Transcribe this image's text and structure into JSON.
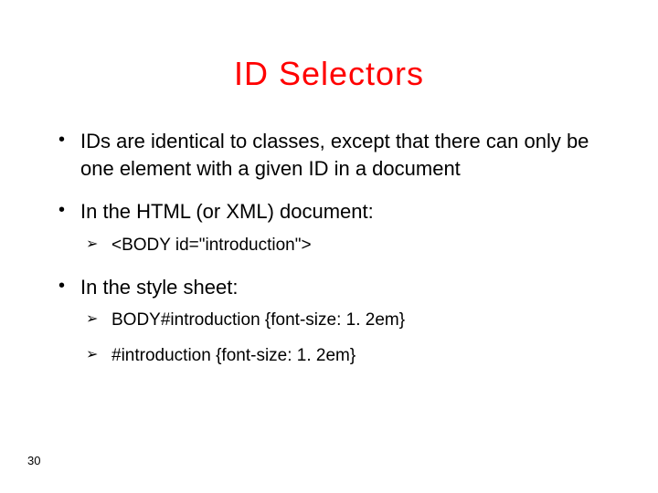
{
  "title": "ID Selectors",
  "bullets": [
    {
      "text": "IDs are identical to classes, except that there can only be one element with a given ID in a document",
      "subitems": []
    },
    {
      "text": "In the HTML (or XML) document:",
      "subitems": [
        "<BODY id=\"introduction\">"
      ]
    },
    {
      "text": "In the style sheet:",
      "subitems": [
        "BODY#introduction {font-size: 1. 2em}",
        "#introduction {font-size: 1. 2em}"
      ]
    }
  ],
  "page_number": "30"
}
